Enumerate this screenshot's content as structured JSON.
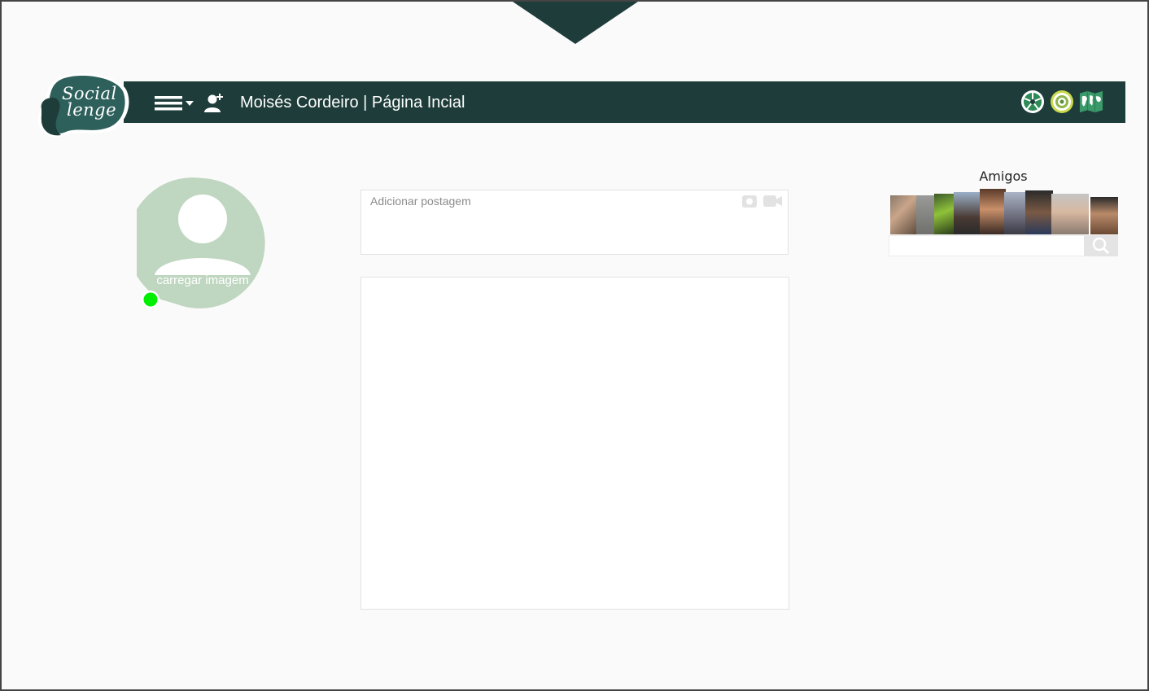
{
  "header": {
    "logo_text_line1": "Social",
    "logo_text_line2": "lenge",
    "title": "Moisés Cordeiro | Página Incial",
    "menu_icon": "hamburger-menu-icon",
    "add_friend_icon": "add-person-icon",
    "right_icons": [
      "aperture-icon",
      "target-icon",
      "world-map-icon"
    ]
  },
  "profile": {
    "upload_label": "carregar imagem",
    "status": "online",
    "status_color": "#00ee00"
  },
  "post": {
    "placeholder": "Adicionar postagem",
    "icons": [
      "camera-icon",
      "video-icon"
    ]
  },
  "friends": {
    "title": "Amigos",
    "search_placeholder": "",
    "search_icon": "search-icon"
  },
  "colors": {
    "navbar": "#1e3d3a",
    "logo_bg": "#2d5f5b",
    "avatar_bg": "#bfd6c0",
    "frame_border": "#444444",
    "background": "#fafafa"
  }
}
